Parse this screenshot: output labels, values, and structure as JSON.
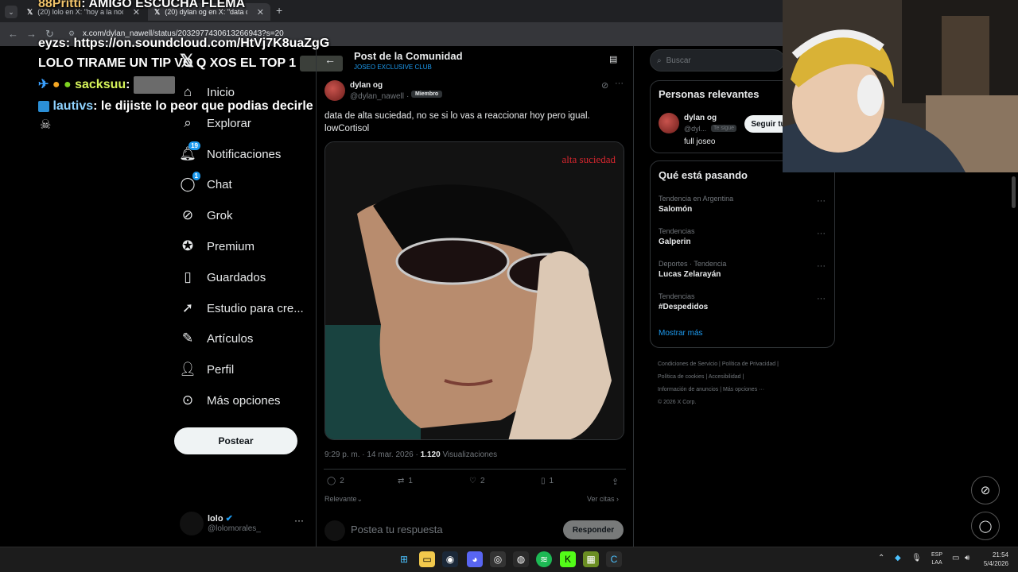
{
  "browser": {
    "tabs": [
      {
        "title": "(20) lolo en X: \"hoy a la noche...",
        "active": false
      },
      {
        "title": "(20) dylan og en X: \"data de alt...",
        "active": true
      }
    ],
    "new_tab": "+",
    "url": "x.com/dylan_nawell/status/2032977430613266943?s=20"
  },
  "overlay_chat": [
    {
      "user": "88Pritti",
      "text": "AMIGO ESCUCHA FLEMA"
    },
    {
      "user": "eyzs",
      "text": "https://on.soundcloud.com/HtVj7K8uaZgG"
    },
    {
      "user": "",
      "text": "LOLO TIRAME UN TIP VO Q XOS EL TOP 1"
    },
    {
      "user": "sacksuu",
      "text": ""
    },
    {
      "user": "lautivs",
      "text": "le dijiste lo peor que podias decirle"
    }
  ],
  "nav": {
    "items": [
      {
        "label": "Inicio",
        "icon": "home-icon"
      },
      {
        "label": "Explorar",
        "icon": "search-icon"
      },
      {
        "label": "Notificaciones",
        "icon": "bell-icon",
        "badge": "19"
      },
      {
        "label": "Chat",
        "icon": "chat-icon",
        "badge": "1"
      },
      {
        "label": "Grok",
        "icon": "grok-icon"
      },
      {
        "label": "Premium",
        "icon": "premium-icon"
      },
      {
        "label": "Guardados",
        "icon": "bookmark-icon"
      },
      {
        "label": "Estudio para cre...",
        "icon": "rocket-icon"
      },
      {
        "label": "Artículos",
        "icon": "article-icon"
      },
      {
        "label": "Perfil",
        "icon": "person-icon"
      },
      {
        "label": "Más opciones",
        "icon": "more-icon"
      }
    ],
    "post_button": "Postear",
    "account": {
      "name": "lolo",
      "handle": "@lolomorales_"
    }
  },
  "header": {
    "title": "Post de la Comunidad",
    "community": "JOSEO EXCLUSIVE CLUB"
  },
  "post": {
    "author": "dylan og",
    "handle": "@dylan_nawell",
    "role_badge": "Miembro",
    "text_line1": "data de alta suciedad, no se si lo vas a reaccionar hoy pero igual.",
    "text_line2": "lowCortisol",
    "image_caption": "alta suciedad",
    "time": "9:29 p. m. · 14 mar. 2026 ·",
    "views": "1.120",
    "views_label": "Visualizaciones",
    "replies": "2",
    "reposts": "1",
    "likes": "2",
    "bookmarks": "1",
    "sort_label": "Relevante",
    "quotes_link": "Ver citas",
    "reply_placeholder": "Postea tu respuesta",
    "reply_button": "Responder"
  },
  "sidebar": {
    "search_placeholder": "Buscar",
    "relevant_title": "Personas relevantes",
    "relevant_person": {
      "name": "dylan og",
      "handle": "@dyl...",
      "follows_you": "Te sigue",
      "bio": "full joseo",
      "follow_button": "Seguir tu"
    },
    "trends_title": "Qué está pasando",
    "trends": [
      {
        "category": "Tendencia en Argentina",
        "name": "Salomón"
      },
      {
        "category": "Tendencias",
        "name": "Galperin"
      },
      {
        "category": "Deportes · Tendencia",
        "name": "Lucas Zelarayán"
      },
      {
        "category": "Tendencias",
        "name": "#Despedidos"
      }
    ],
    "show_more": "Mostrar más",
    "footer": {
      "l1a": "Condiciones de Servicio",
      "l1b": "Política de Privacidad",
      "l2a": "Política de cookies",
      "l2b": "Accesibilidad",
      "l3a": "Información de anuncios",
      "l3b": "Más opciones ···",
      "copyright": "© 2026 X Corp."
    }
  },
  "taskbar": {
    "lang1": "ESP",
    "lang2": "LAA",
    "time": "21:54",
    "date": "5/4/2026"
  },
  "colors": {
    "accent": "#1d9bf0",
    "background": "#000000",
    "border": "#2f3336",
    "muted": "#71767b"
  }
}
